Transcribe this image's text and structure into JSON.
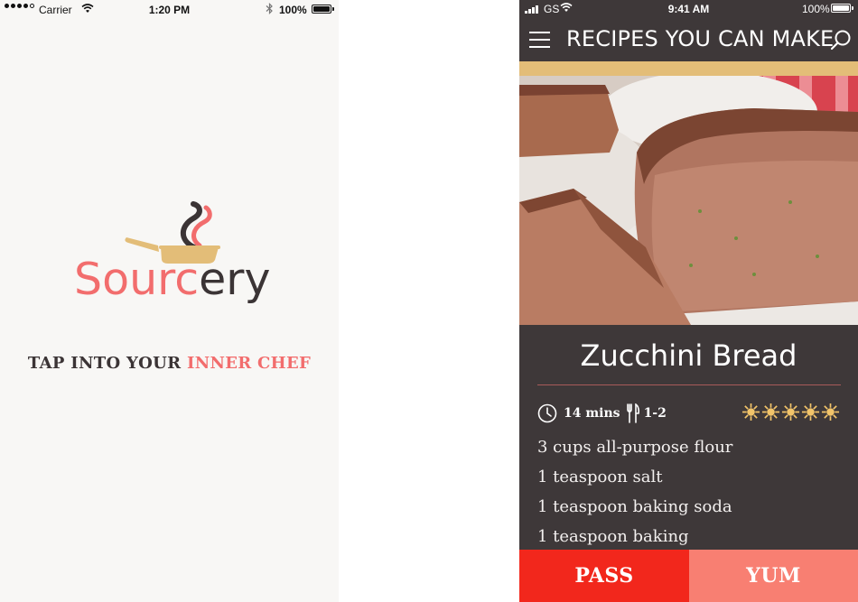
{
  "splash_screen": {
    "status_bar": {
      "carrier": "Carrier",
      "time": "1:20 PM",
      "battery": "100%"
    },
    "logo": {
      "text_primary": "Sourc",
      "text_accent": "ery",
      "icon": "smoking-pan-icon"
    },
    "tagline": {
      "prefix": "TAP INTO YOUR ",
      "accent": "INNER CHEF"
    }
  },
  "recipe_screen": {
    "status_bar": {
      "carrier": "GS",
      "time": "9:41 AM",
      "battery": "100%"
    },
    "header": {
      "title": "RECIPES YOU CAN MAKE",
      "menu_icon": "hamburger-icon",
      "search_icon": "search-icon"
    },
    "recipe": {
      "name": "Zucchini Bread",
      "time": "14 mins",
      "serves": "1-2",
      "rating": 5,
      "rating_max": 5,
      "ingredients": [
        "3 cups all-purpose flour",
        "1 teaspoon salt",
        "1 teaspoon baking soda",
        "1 teaspoon baking"
      ]
    },
    "actions": {
      "pass": "PASS",
      "yum": "YUM"
    }
  },
  "colors": {
    "brand_pink": "#f26d6d",
    "brand_dark": "#3b3435",
    "gold": "#e3bd78",
    "pass_red": "#f2271c",
    "yum_salmon": "#f87f72",
    "panel_bg": "#3e3839"
  }
}
